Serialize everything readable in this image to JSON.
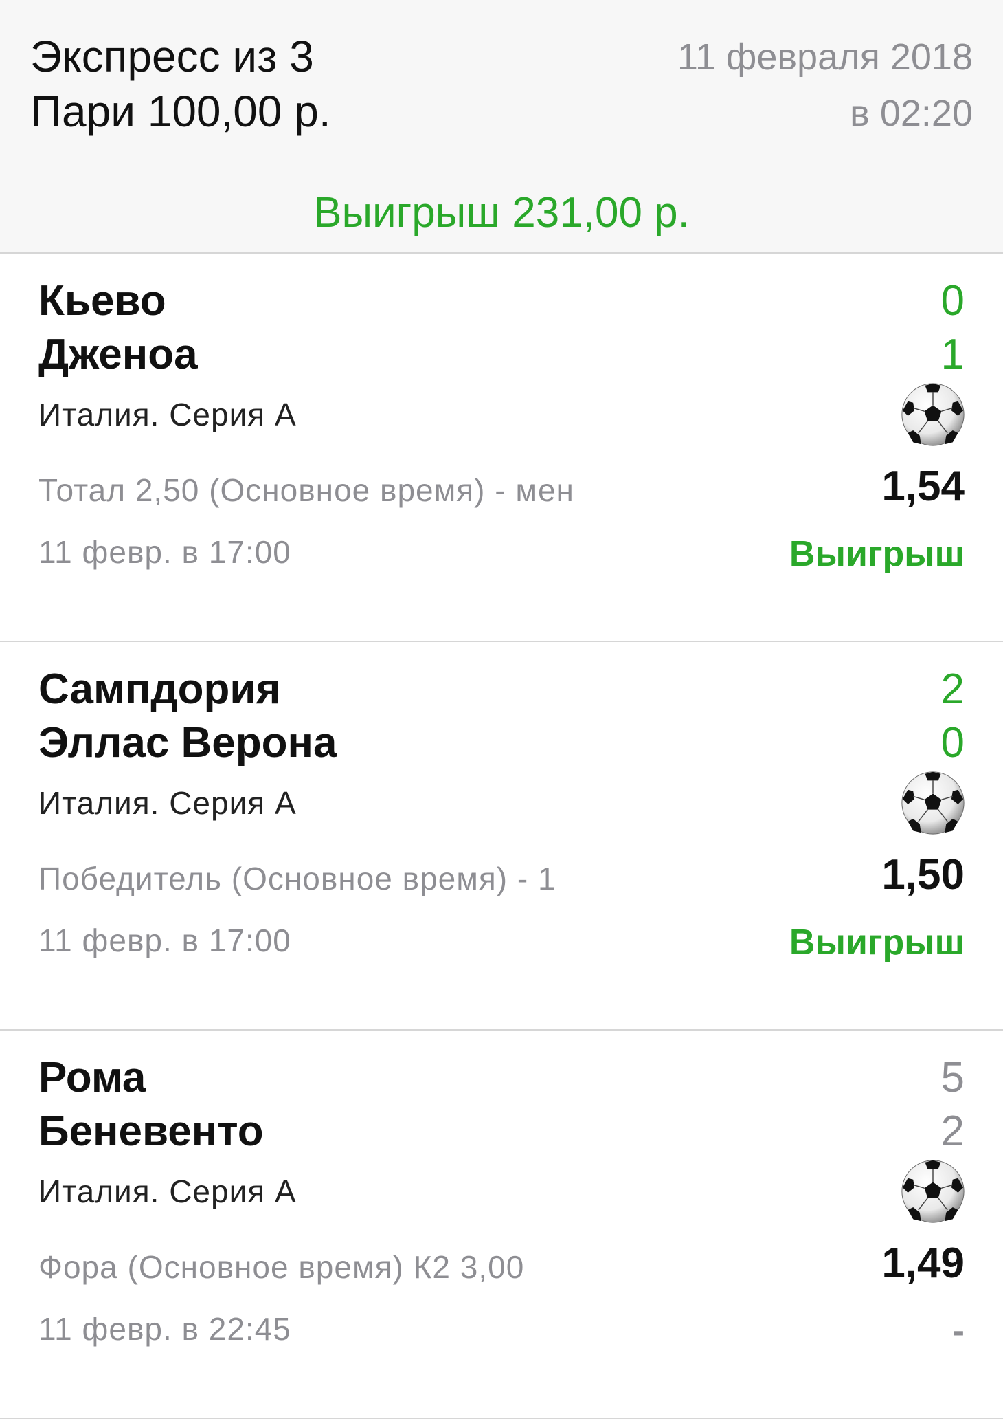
{
  "header": {
    "title": "Экспресс из 3",
    "stake": "Пари 100,00 р.",
    "date": "11 февраля 2018",
    "time": "в 02:20",
    "payout": "Выигрыш 231,00 р."
  },
  "events": [
    {
      "team1": "Кьево",
      "team2": "Дженоа",
      "score1": "0",
      "score2": "1",
      "score_color": "green",
      "league": "Италия. Серия А",
      "sport_icon": "soccer-ball-icon",
      "market": "Тотал 2,50 (Основное время) - мен",
      "odds": "1,54",
      "time": "11 февр. в 17:00",
      "result": "Выигрыш",
      "result_color": "green"
    },
    {
      "team1": "Сампдория",
      "team2": "Эллас Верона",
      "score1": "2",
      "score2": "0",
      "score_color": "green",
      "league": "Италия. Серия А",
      "sport_icon": "soccer-ball-icon",
      "market": "Победитель (Основное время) - 1",
      "odds": "1,50",
      "time": "11 февр. в 17:00",
      "result": "Выигрыш",
      "result_color": "green"
    },
    {
      "team1": "Рома",
      "team2": "Беневенто",
      "score1": "5",
      "score2": "2",
      "score_color": "gray",
      "league": "Италия. Серия А",
      "sport_icon": "soccer-ball-icon",
      "market": "Фора (Основное время) К2 3,00",
      "odds": "1,49",
      "time": "11 февр. в 22:45",
      "result": "-",
      "result_color": "gray"
    }
  ],
  "colors": {
    "win_green": "#2aa82a",
    "secondary_gray": "#8e8e93",
    "header_bg": "#f7f7f7",
    "divider": "#d6d6d6"
  }
}
